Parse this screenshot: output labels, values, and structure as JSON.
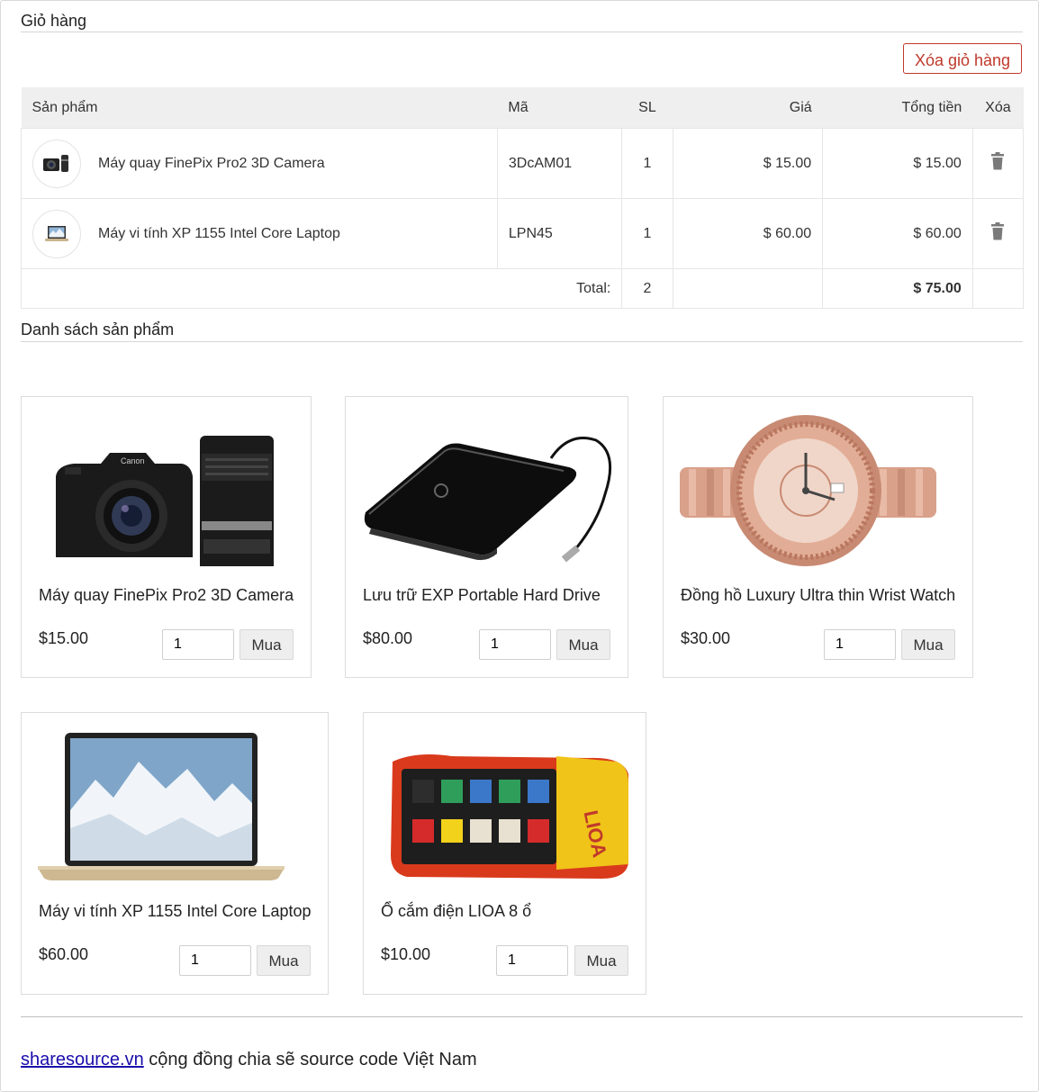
{
  "cart": {
    "title": "Giỏ hàng",
    "clear_label": "Xóa giỏ hàng",
    "columns": [
      "Sản phẩm",
      "Mã",
      "SL",
      "Giá",
      "Tổng tiền",
      "Xóa"
    ],
    "items": [
      {
        "name": "Máy quay FinePix Pro2 3D Camera",
        "code": "3DcAM01",
        "qty": "1",
        "price": "$ 15.00",
        "total": "$ 15.00",
        "icon": "camera"
      },
      {
        "name": "Máy vi tính XP 1155 Intel Core Laptop",
        "code": "LPN45",
        "qty": "1",
        "price": "$ 60.00",
        "total": "$ 60.00",
        "icon": "laptop"
      }
    ],
    "total_label": "Total:",
    "total_qty": "2",
    "total_amount": "$ 75.00"
  },
  "products": {
    "title": "Danh sách sản phẩm",
    "buy_label": "Mua",
    "qty_default": "1",
    "items": [
      {
        "name": "Máy quay FinePix Pro2 3D Camera",
        "price": "$15.00",
        "image": "dslr-camera"
      },
      {
        "name": "Lưu trữ EXP Portable Hard Drive",
        "price": "$80.00",
        "image": "hard-drive"
      },
      {
        "name": "Đồng hồ Luxury Ultra thin Wrist Watch",
        "price": "$30.00",
        "image": "wrist-watch"
      },
      {
        "name": "Máy vi tính XP 1155 Intel Core Laptop",
        "price": "$60.00",
        "image": "laptop"
      },
      {
        "name": "Ổ cắm điện LIOA 8 ổ",
        "price": "$10.00",
        "image": "power-strip",
        "brand_text": "LIOA"
      }
    ]
  },
  "footer": {
    "link": "sharesource.vn",
    "text": " cộng đồng chia sẽ source code Việt Nam"
  },
  "colors": {
    "accent_red": "#c0392b",
    "link": "#1a0dab",
    "header_bg": "#efefef"
  }
}
